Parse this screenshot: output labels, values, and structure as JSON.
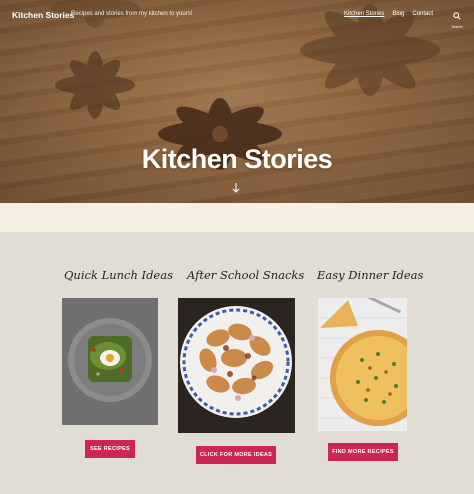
{
  "header": {
    "site_title": "Kitchen Stories",
    "site_description": "Recipes and stories from my kitchen to yours!",
    "nav": [
      "Kitchen Stories",
      "Blog",
      "Contact"
    ],
    "search_label": "Search"
  },
  "hero": {
    "title": "Kitchen Stories"
  },
  "cards": [
    {
      "title": "Quick Lunch Ideas",
      "button": "SEE RECIPES"
    },
    {
      "title": "After School Snacks",
      "button": "CLICK FOR MORE IDEAS"
    },
    {
      "title": "Easy Dinner Ideas",
      "button": "FIND MORE RECIPES"
    }
  ],
  "colors": {
    "accent": "#cd2653",
    "section_bg": "#e2ddd4",
    "band": "#f5efe1"
  }
}
